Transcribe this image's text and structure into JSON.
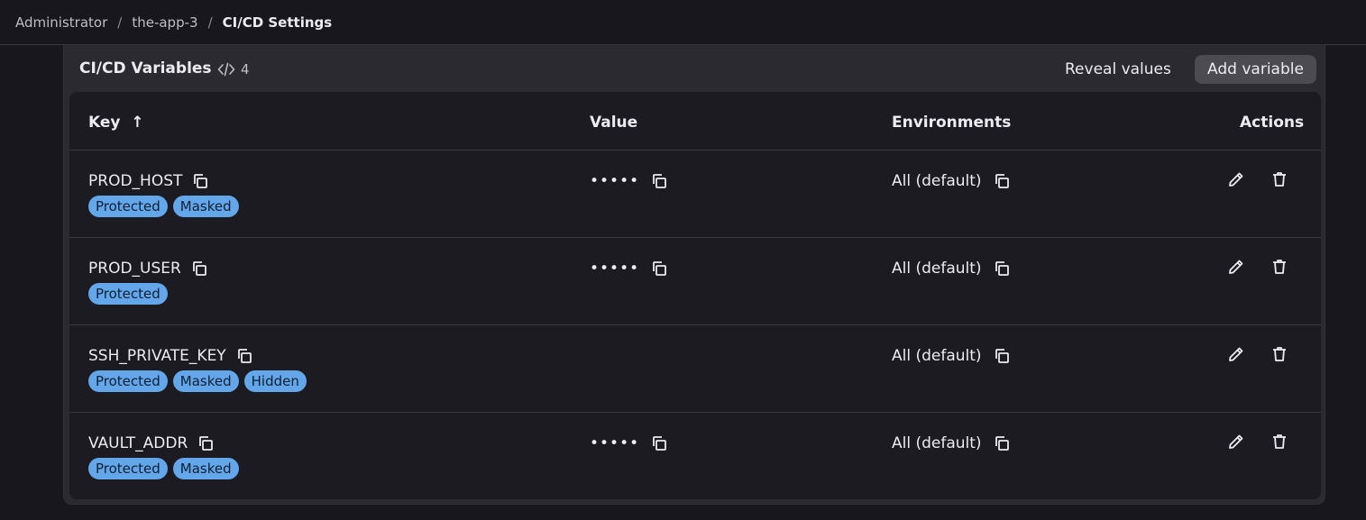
{
  "breadcrumb": {
    "items": [
      "Administrator",
      "the-app-3"
    ],
    "current": "CI/CD Settings",
    "separator": "/"
  },
  "card": {
    "title": "CI/CD Variables",
    "count": "4",
    "reveal_label": "Reveal values",
    "add_label": "Add variable"
  },
  "table": {
    "headers": {
      "key": "Key",
      "sort_arrow": "↑",
      "value": "Value",
      "environments": "Environments",
      "actions": "Actions"
    },
    "rows": [
      {
        "key": "PROD_HOST",
        "badges": [
          "Protected",
          "Masked"
        ],
        "value": "•••••",
        "env": "All (default)"
      },
      {
        "key": "PROD_USER",
        "badges": [
          "Protected"
        ],
        "value": "•••••",
        "env": "All (default)"
      },
      {
        "key": "SSH_PRIVATE_KEY",
        "badges": [
          "Protected",
          "Masked",
          "Hidden"
        ],
        "value": "",
        "env": "All (default)"
      },
      {
        "key": "VAULT_ADDR",
        "badges": [
          "Protected",
          "Masked"
        ],
        "value": "•••••",
        "env": "All (default)"
      }
    ]
  },
  "colors": {
    "badge": "#63a6e9",
    "background": "#18171d",
    "card": "#2b2a31"
  }
}
